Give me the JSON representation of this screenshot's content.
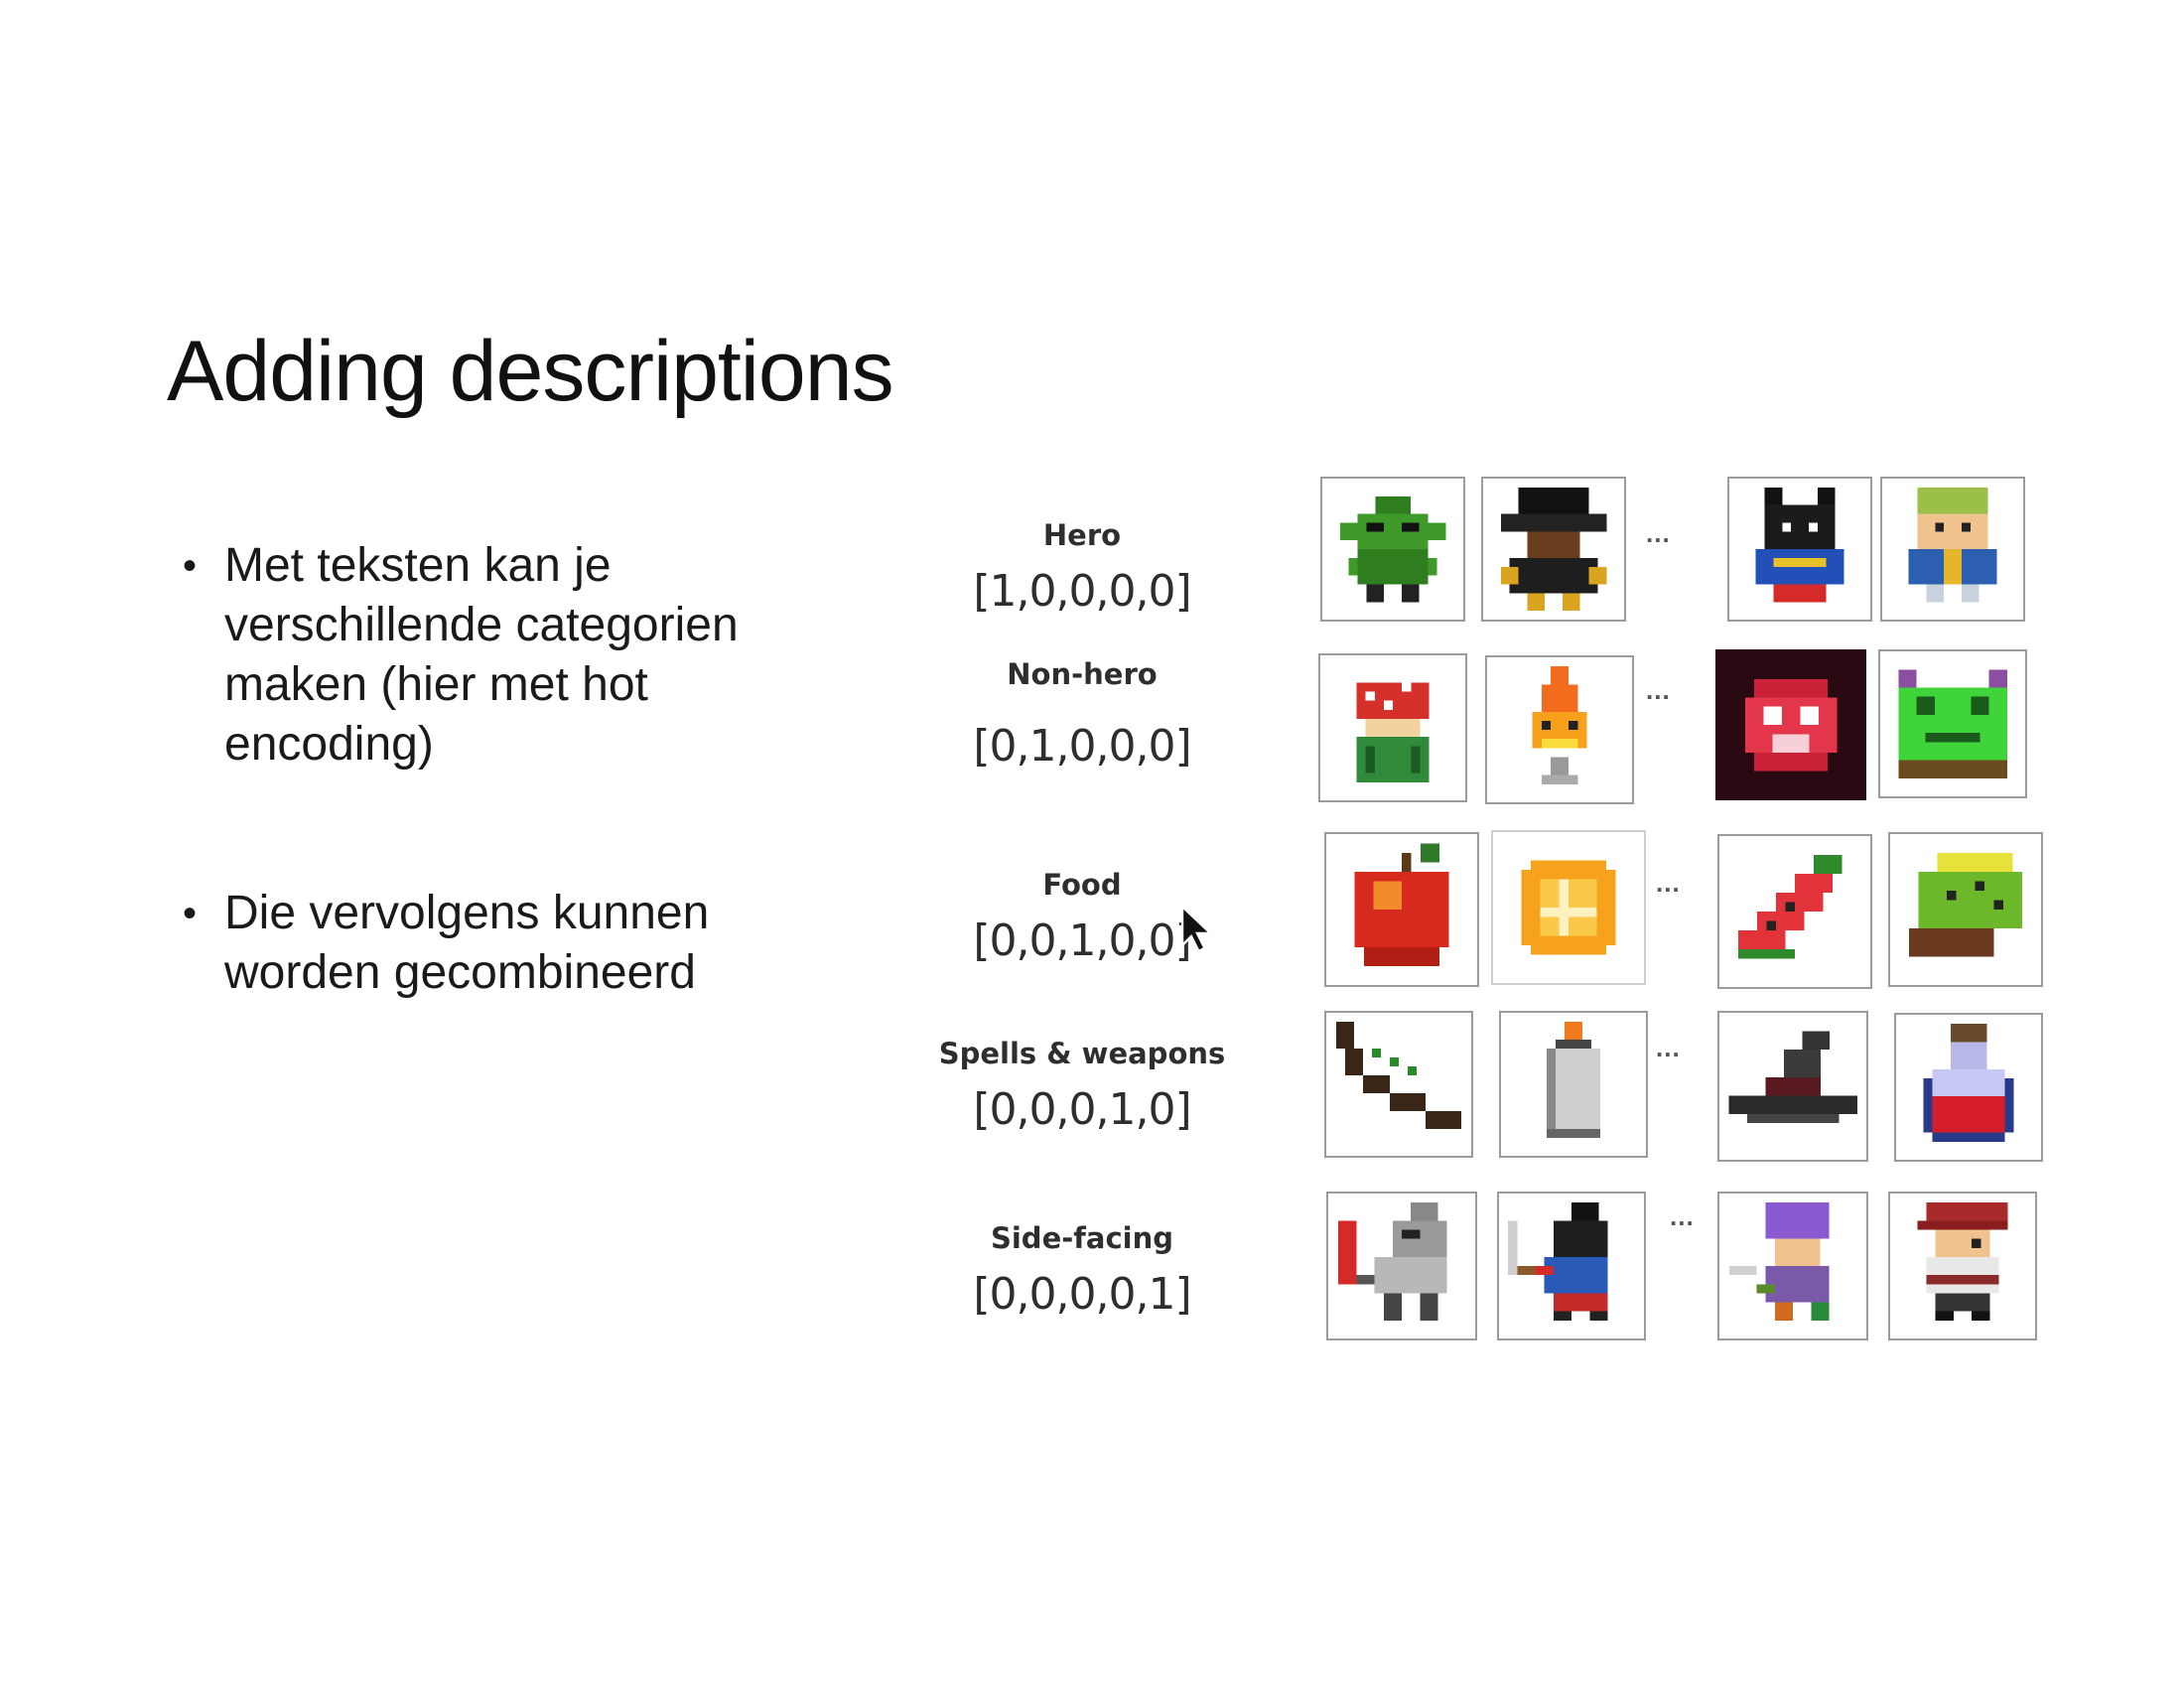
{
  "slide": {
    "title": "Adding descriptions",
    "bullets": [
      "Met teksten kan je verschillende categorien maken (hier met hot encoding)",
      "Die vervolgens kunnen worden gecombineerd"
    ],
    "bullet_glyph": "•"
  },
  "figure": {
    "ellipsis": "...",
    "categories": [
      {
        "name": "Hero",
        "vector": "[1,0,0,0,0]",
        "icons": [
          "green-goblin-icon",
          "hooded-hero-icon",
          "bat-knight-icon",
          "blonde-hero-icon"
        ]
      },
      {
        "name": "Non-hero",
        "vector": "[0,1,0,0,0]",
        "icons": [
          "mushroom-creature-icon",
          "fire-spirit-icon",
          "red-blob-icon",
          "green-frog-monster-icon"
        ]
      },
      {
        "name": "Food",
        "vector": "[0,0,1,0,0]",
        "icons": [
          "apple-icon",
          "orange-slice-icon",
          "watermelon-icon",
          "kiwi-icon"
        ]
      },
      {
        "name": "Spells & weapons",
        "vector": "[0,0,0,1,0]",
        "icons": [
          "bow-icon",
          "candle-icon",
          "witch-hat-icon",
          "potion-icon"
        ]
      },
      {
        "name": "Side-facing",
        "vector": "[0,0,0,0,1]",
        "icons": [
          "armored-knight-icon",
          "ninja-swordsman-icon",
          "purple-hair-mage-icon",
          "red-cap-hero-icon"
        ]
      }
    ]
  }
}
